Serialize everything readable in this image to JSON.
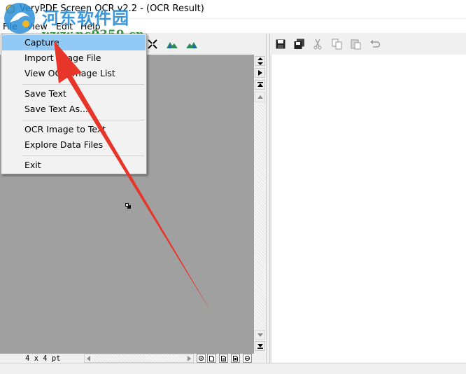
{
  "window": {
    "title": "VeryPDF Screen OCR v2.2 - (OCR Result)"
  },
  "menubar": {
    "items": [
      "File",
      "View",
      "Edit",
      "Help"
    ]
  },
  "file_menu": {
    "items": [
      {
        "label": "Capture",
        "highlighted": true
      },
      {
        "label": "Import Image File"
      },
      {
        "label": "View OCR Image List"
      },
      {
        "label": "Save Text"
      },
      {
        "label": "Save Text As..."
      },
      {
        "label": "OCR Image to Text"
      },
      {
        "label": "Explore Data Files"
      },
      {
        "label": "Exit"
      }
    ]
  },
  "image_panel": {
    "size_label": "4 x 4 pt"
  },
  "watermark": {
    "name": "河东软件园",
    "url": "www.pc0359.cn"
  },
  "colors": {
    "menu_highlight": "#91c9f7",
    "image_background": "#a0a0a0",
    "annotation_arrow": "#e8352a"
  }
}
